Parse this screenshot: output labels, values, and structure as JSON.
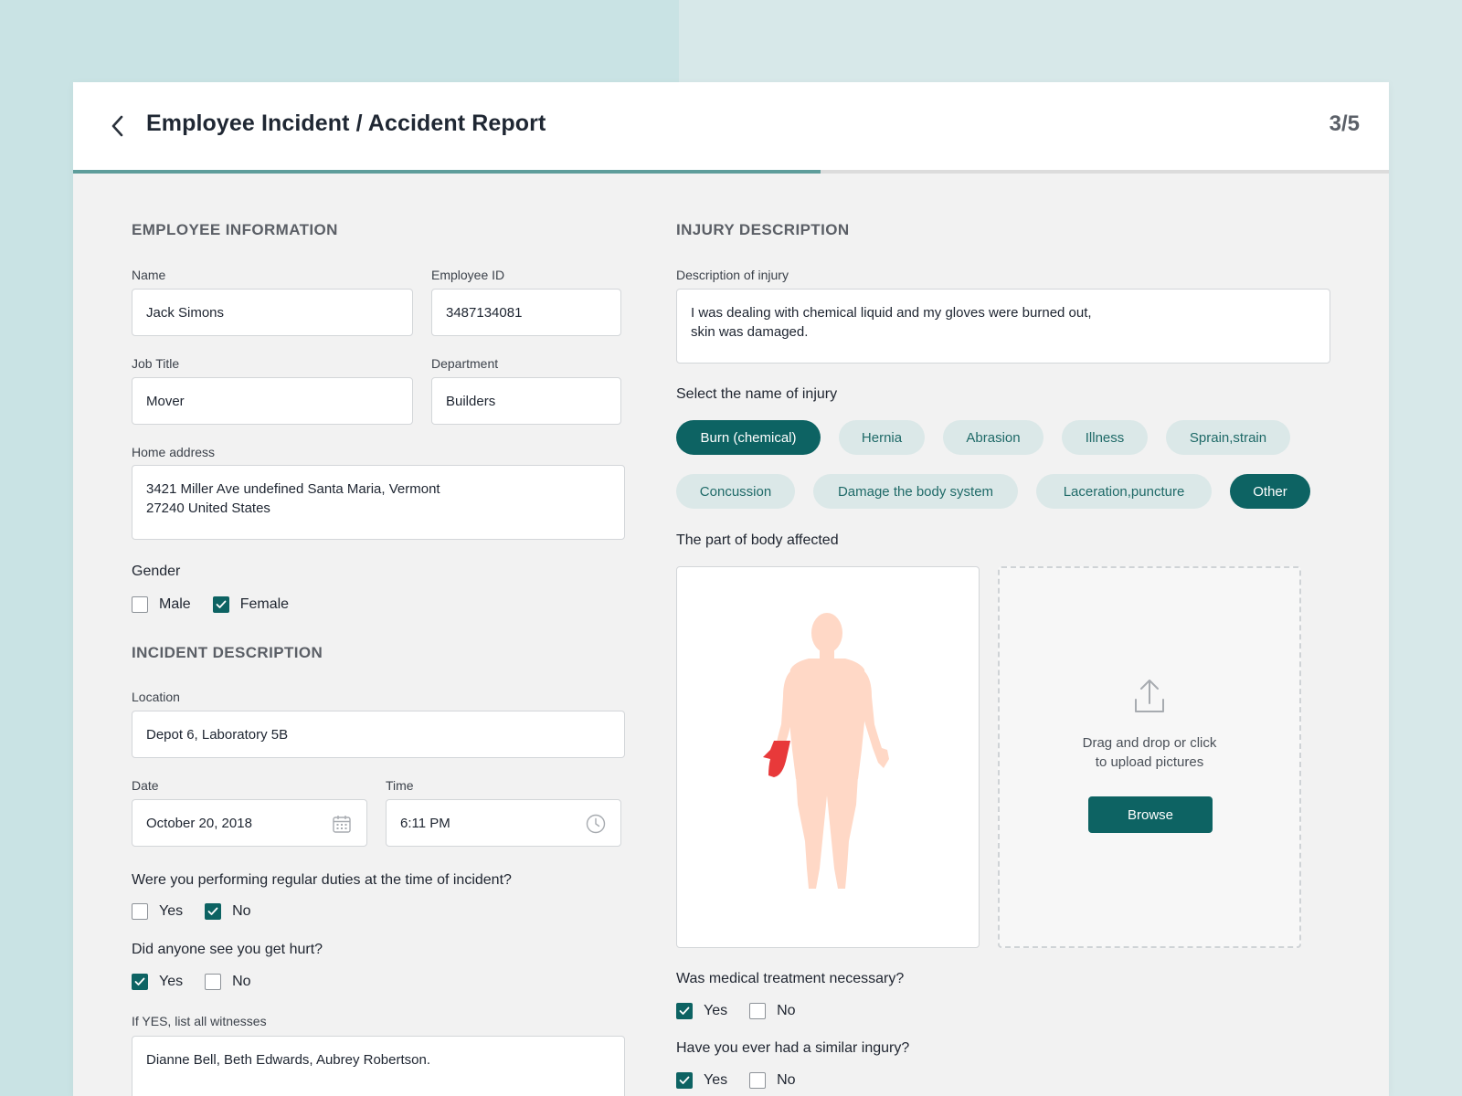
{
  "header": {
    "title": "Employee Incident / Accident Report",
    "step": "3/5",
    "progress": 0.568
  },
  "employee": {
    "section_title": "EMPLOYEE INFORMATION",
    "name_label": "Name",
    "name_value": "Jack Simons",
    "id_label": "Employee ID",
    "id_value": "3487134081",
    "job_label": "Job Title",
    "job_value": "Mover",
    "dept_label": "Department",
    "dept_value": "Builders",
    "address_label": "Home address",
    "address_value": "3421 Miller Ave undefined Santa Maria, Vermont\n27240 United States",
    "gender_label": "Gender",
    "gender_options": [
      {
        "label": "Male",
        "checked": false
      },
      {
        "label": "Female",
        "checked": true
      }
    ]
  },
  "incident": {
    "section_title": "INCIDENT DESCRIPTION",
    "location_label": "Location",
    "location_value": "Depot 6, Laboratory 5B",
    "date_label": "Date",
    "date_value": "October 20, 2018",
    "time_label": "Time",
    "time_value": "6:11 PM",
    "regular_duties_question": "Were you performing regular duties at the time of incident?",
    "regular_duties_options": [
      {
        "label": "Yes",
        "checked": false
      },
      {
        "label": "No",
        "checked": true
      }
    ],
    "seen_question": "Did anyone see you get hurt?",
    "seen_options": [
      {
        "label": "Yes",
        "checked": true
      },
      {
        "label": "No",
        "checked": false
      }
    ],
    "witnesses_label": "If YES, list all witnesses",
    "witnesses_value": "Dianne Bell, Beth Edwards, Aubrey Robertson."
  },
  "injury": {
    "section_title": "INJURY DESCRIPTION",
    "description_label": "Description of injury",
    "description_value": "I was dealing with chemical liquid and my gloves were burned out,\nskin was damaged.",
    "injury_name_label": "Select the name of injury",
    "injury_chips": [
      {
        "label": "Burn (chemical)",
        "selected": true
      },
      {
        "label": "Hernia",
        "selected": false
      },
      {
        "label": "Abrasion",
        "selected": false
      },
      {
        "label": "Illness",
        "selected": false
      },
      {
        "label": "Sprain,strain",
        "selected": false
      },
      {
        "label": "Concussion",
        "selected": false
      },
      {
        "label": "Damage the body system",
        "selected": false
      },
      {
        "label": "Laceration,puncture",
        "selected": false
      },
      {
        "label": "Other",
        "selected": true
      }
    ],
    "body_part_label": "The part of body affected",
    "upload_text_line1": "Drag and drop or click",
    "upload_text_line2": "to upload pictures",
    "browse_label": "Browse",
    "medical_question": "Was medical treatment necessary?",
    "medical_options": [
      {
        "label": "Yes",
        "checked": true
      },
      {
        "label": "No",
        "checked": false
      }
    ],
    "similar_question": "Have you ever had a similar ingury?",
    "similar_options": [
      {
        "label": "Yes",
        "checked": true
      },
      {
        "label": "No",
        "checked": false
      }
    ]
  },
  "colors": {
    "accent": "#0d6363",
    "chip_bg": "#dbe8e8",
    "body_silhouette": "#ffd8c6",
    "injury_highlight": "#e8393a"
  },
  "icons": [
    "back-icon",
    "calendar-icon",
    "clock-icon",
    "upload-icon",
    "checkmark-icon"
  ]
}
